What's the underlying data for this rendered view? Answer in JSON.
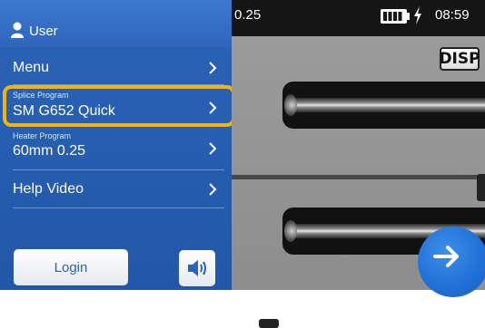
{
  "sidebar": {
    "user_label": "User",
    "items": [
      {
        "small": "",
        "label": "Menu"
      },
      {
        "small": "Splice Program",
        "label": "SM G652 Quick"
      },
      {
        "small": "Heater Program",
        "label": "60mm 0.25"
      },
      {
        "small": "",
        "label": "Help Video"
      }
    ],
    "login_label": "Login"
  },
  "status": {
    "left_value": "0.25",
    "clock": "08:59"
  },
  "viewer": {
    "disp_label": "DISP"
  },
  "colors": {
    "accent": "#2a64b8",
    "highlight": "#f5b30d",
    "next_button": "#1f6fd6"
  },
  "icons": [
    "user-icon",
    "chevron-right-icon",
    "speaker-icon",
    "battery-icon",
    "charging-bolt-icon",
    "arrow-right-icon"
  ]
}
